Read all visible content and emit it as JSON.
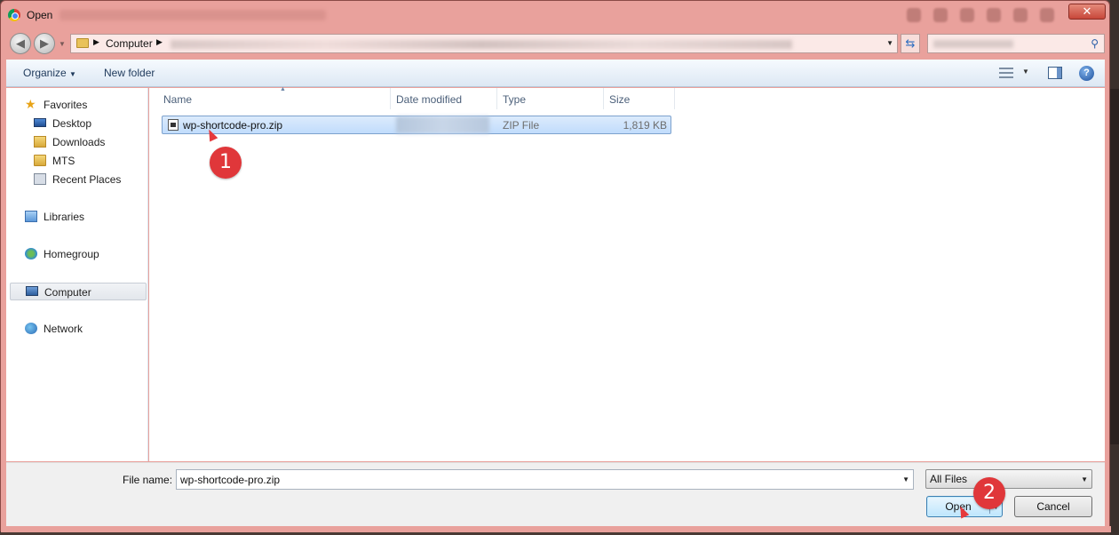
{
  "window": {
    "title": "Open",
    "accent_color": "#e9a19c"
  },
  "address_bar": {
    "crumb": "Computer"
  },
  "toolbar": {
    "organize_label": "Organize",
    "new_folder_label": "New folder"
  },
  "nav": {
    "favorites_label": "Favorites",
    "favorites_items": [
      {
        "label": "Desktop",
        "icon": "desktop-icon"
      },
      {
        "label": "Downloads",
        "icon": "downloads-folder-icon"
      },
      {
        "label": "MTS",
        "icon": "folder-icon"
      },
      {
        "label": "Recent Places",
        "icon": "recent-places-icon"
      }
    ],
    "libraries_label": "Libraries",
    "homegroup_label": "Homegroup",
    "computer_label": "Computer",
    "network_label": "Network",
    "selected": "Computer"
  },
  "columns": {
    "name": "Name",
    "date_modified": "Date modified",
    "type": "Type",
    "size": "Size"
  },
  "files": [
    {
      "name": "wp-shortcode-pro.zip",
      "type": "ZIP File",
      "size": "1,819 KB",
      "selected": true
    }
  ],
  "annotations": {
    "step1": "1",
    "step2": "2",
    "badge_color": "#e0373a"
  },
  "footer": {
    "file_name_label": "File name:",
    "file_name_value": "wp-shortcode-pro.zip",
    "filter_value": "All Files",
    "open_label": "Open",
    "cancel_label": "Cancel"
  }
}
